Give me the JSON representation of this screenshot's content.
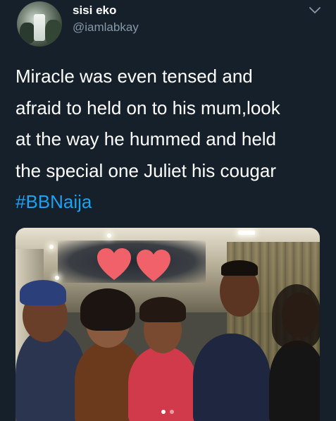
{
  "tweet": {
    "author": {
      "display_name": "sisi eko",
      "handle": "@iamlabkay",
      "avatar_icon": "waterfall-avatar"
    },
    "menu_icon": "chevron-down-icon",
    "text_lines": [
      "Miracle was even tensed and",
      "afraid to held on to his mum,look",
      "at the way he hummed and held",
      "the special one Juliet his cougar"
    ],
    "hashtag": "#BBNaija",
    "media": {
      "type": "photo",
      "carousel_dots": 2,
      "active_dot": 0,
      "heart_icon": "heart-icon"
    }
  },
  "colors": {
    "background": "#15202b",
    "text": "#ffffff",
    "secondary_text": "#8899a6",
    "link": "#1da1f2",
    "heart": "#f0616a"
  }
}
